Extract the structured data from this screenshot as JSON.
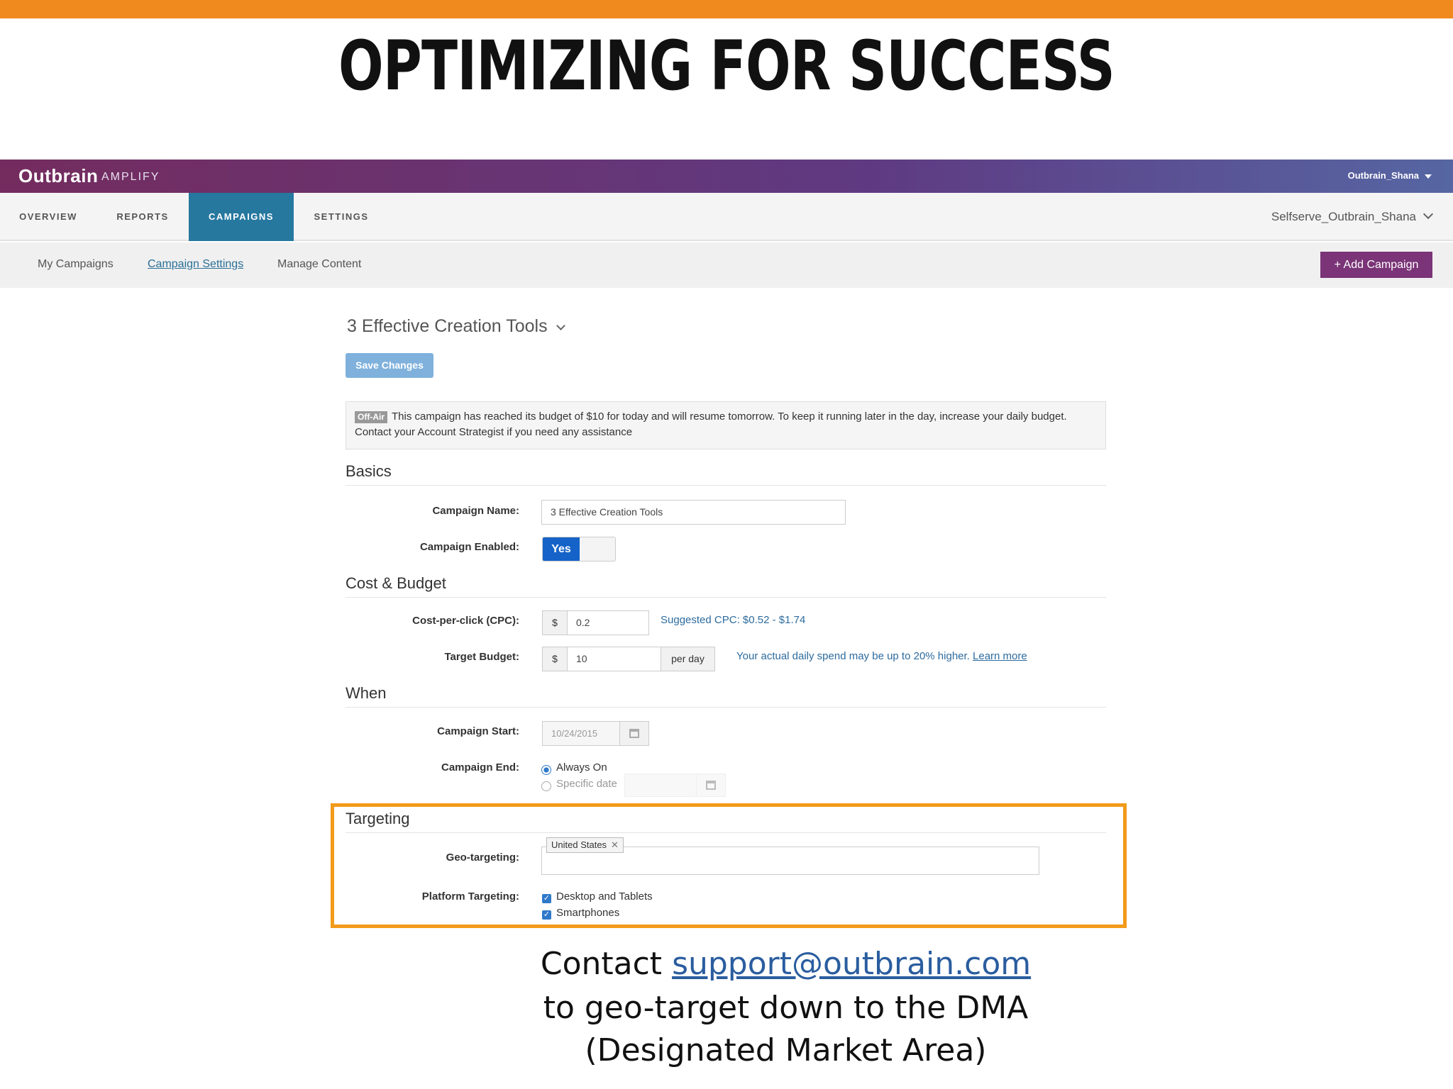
{
  "slide_title": "OPTIMIZING FOR SUCCESS",
  "app": {
    "logo": "Outbrain",
    "logo_sub": "AMPLIFY",
    "user": "Outbrain_Shana"
  },
  "nav": {
    "tabs": [
      "OVERVIEW",
      "REPORTS",
      "CAMPAIGNS",
      "SETTINGS"
    ],
    "active_tab": "CAMPAIGNS",
    "account": "Selfserve_Outbrain_Shana"
  },
  "subnav": {
    "items": [
      "My Campaigns",
      "Campaign Settings",
      "Manage Content"
    ],
    "active": "Campaign Settings",
    "add_button": "+ Add Campaign"
  },
  "campaign": {
    "title": "3 Effective Creation Tools",
    "save_button": "Save Changes",
    "alert_badge": "Off-Air",
    "alert_text": "This campaign has reached its budget of $10 for today and will resume tomorrow. To keep it running later in the day, increase your daily budget. Contact your Account Strategist if you need any assistance"
  },
  "basics": {
    "heading": "Basics",
    "name_label": "Campaign Name:",
    "name_value": "3 Effective Creation Tools",
    "enabled_label": "Campaign Enabled:",
    "enabled_value": "Yes"
  },
  "cost": {
    "heading": "Cost & Budget",
    "cpc_label": "Cost-per-click (CPC):",
    "currency": "$",
    "cpc_value": "0.2",
    "cpc_hint": "Suggested CPC: $0.52 - $1.74",
    "budget_label": "Target Budget:",
    "budget_value": "10",
    "budget_unit": "per day",
    "budget_hint": "Your actual daily spend may be up to 20% higher.",
    "learn_more": "Learn more"
  },
  "when": {
    "heading": "When",
    "start_label": "Campaign Start:",
    "start_value": "10/24/2015",
    "end_label": "Campaign End:",
    "opt_always": "Always On",
    "opt_specific": "Specific date"
  },
  "targeting": {
    "heading": "Targeting",
    "geo_label": "Geo-targeting:",
    "geo_tag": "United States",
    "platform_label": "Platform Targeting:",
    "platform_1": "Desktop and Tablets",
    "platform_2": "Smartphones"
  },
  "caption": {
    "line1_prefix": "Contact ",
    "email": "support@outbrain.com",
    "line2": "to geo-target down to the DMA",
    "line3": "(Designated Market Area)"
  },
  "colors": {
    "accent_orange": "#f08a1e",
    "nav_active": "#27789f",
    "add_button": "#7a3477",
    "toggle_on": "#1563c8"
  }
}
